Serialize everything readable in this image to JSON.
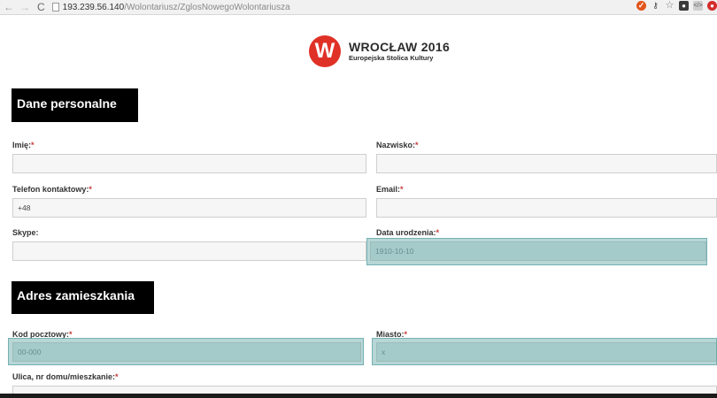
{
  "browser": {
    "url_host": "193.239.56.140",
    "url_path": "/Wolontariusz/ZglosNowegoWolontariusza",
    "back_glyph": "←",
    "forward_glyph": "→",
    "reload_glyph": "C",
    "extension_icons": [
      "extension-icon-orange",
      "key-icon",
      "star-icon",
      "person-icon",
      "code-icon",
      "red-extension-icon"
    ]
  },
  "logo": {
    "mark": "W",
    "title": "WROCŁAW 2016",
    "subtitle": "Europejska Stolica Kultury",
    "brand_color": "#e03127"
  },
  "sections": {
    "personal": "Dane personalne",
    "address": "Adres zamieszkania"
  },
  "required_marker": "*",
  "fields": {
    "first_name": {
      "label": "Imię:",
      "value": ""
    },
    "last_name": {
      "label": "Nazwisko:",
      "value": ""
    },
    "phone": {
      "label": "Telefon kontaktowy:",
      "value": "+48"
    },
    "email": {
      "label": "Email:",
      "value": ""
    },
    "skype": {
      "label": "Skype:",
      "value": ""
    },
    "birth_date": {
      "label": "Data urodzenia:",
      "value": "1910-10-10"
    },
    "postal_code": {
      "label": "Kod pocztowy:",
      "value": "00-000"
    },
    "city": {
      "label": "Miasto:",
      "value": "x"
    },
    "street": {
      "label": "Ulica, nr domu/mieszkanie:",
      "value": ""
    }
  },
  "highlight_color": "#5fa5a5"
}
